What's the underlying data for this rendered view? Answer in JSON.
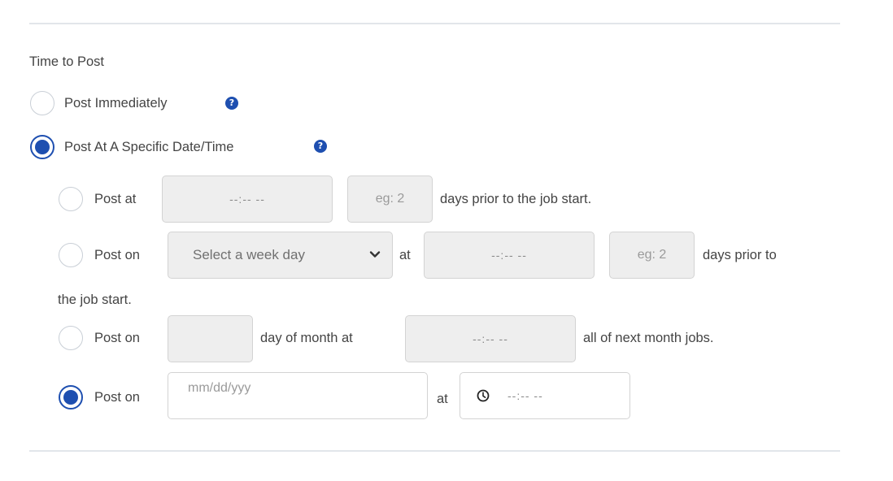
{
  "section_title": "Time to Post",
  "colors": {
    "accent": "#1e4fb0",
    "divider": "#e2e6ea",
    "disabled_field": "#eeeeee"
  },
  "options": {
    "immediately": {
      "label": "Post Immediately",
      "checked": false,
      "help_icon": "?"
    },
    "specific": {
      "label": "Post At A Specific Date/Time",
      "checked": true,
      "help_icon": "?"
    }
  },
  "sub_options": {
    "post_at": {
      "checked": false,
      "label": "Post at",
      "time_placeholder": "--:-- --",
      "days_placeholder": "eg: 2",
      "suffix": "days prior to the job start."
    },
    "post_on_weekday": {
      "checked": false,
      "label": "Post on",
      "select_value": "Select a week day",
      "at_label": "at",
      "time_placeholder": "--:-- --",
      "days_placeholder": "eg: 2",
      "suffix": "days prior to",
      "suffix_wrap": "the job start."
    },
    "post_on_month_day": {
      "checked": false,
      "label": "Post on",
      "day_value": "",
      "middle_label": "day of month at",
      "time_placeholder": "--:-- --",
      "suffix": "all of next month jobs."
    },
    "post_on_date": {
      "checked": true,
      "label": "Post on",
      "date_placeholder": "mm/dd/yyy",
      "at_label": "at",
      "time_placeholder": "--:-- --",
      "time_icon": "clock-icon"
    }
  }
}
